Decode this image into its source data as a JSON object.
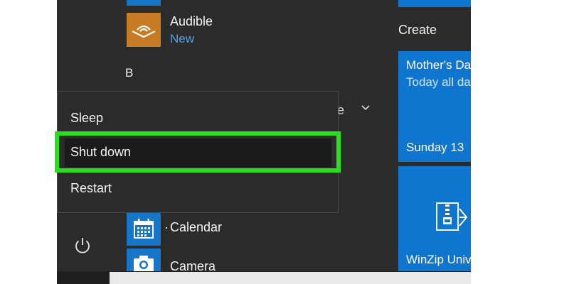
{
  "apps": {
    "audible": {
      "name": "Audible",
      "badge": "New"
    },
    "group_letter": "B",
    "hidden_partial": "e",
    "calendar": {
      "name": "Calendar",
      "prefix_mark": "·"
    },
    "camera": {
      "name": "Camera"
    }
  },
  "tiles": {
    "group_label": "Create",
    "mothers_day": {
      "title": "Mother's Day",
      "subtitle": "Today all day",
      "date": "Sunday 13"
    },
    "winzip": {
      "name": "WinZip Universal"
    }
  },
  "power_menu": {
    "items": [
      "Sleep",
      "Shut down",
      "Restart"
    ],
    "highlighted": "Shut down",
    "highlight_color": "#27e01a"
  },
  "colors": {
    "start_bg": "#2b2b2b",
    "tile_blue": "#0e76cf",
    "audible_orange": "#c77b24",
    "badge_blue": "#4fa3ea"
  },
  "icons": {
    "audible": "audible-waves-icon",
    "calendar": "calendar-icon",
    "camera": "camera-icon",
    "winzip": "winzip-archive-icon",
    "power": "power-icon",
    "chevron": "chevron-down-icon"
  }
}
